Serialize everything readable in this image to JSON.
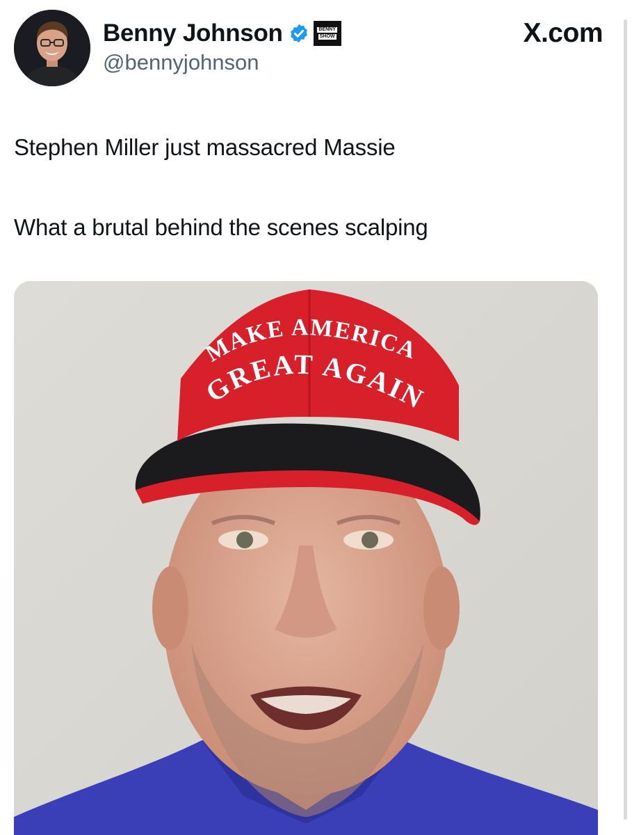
{
  "site_label": "X.com",
  "author": {
    "display_name": "Benny Johnson",
    "handle": "@bennyjohnson",
    "verified": true,
    "affiliate_badge": [
      "BENNY",
      "SHOW"
    ]
  },
  "tweet": {
    "lines": [
      "Stephen Miller just massacred Massie",
      "What a brutal behind the scenes scalping"
    ]
  },
  "media": {
    "hat_text_top": "MAKE AMERICA",
    "hat_text_bottom": "GREAT AGAIN"
  },
  "icons": {
    "verified": "verified-badge-icon",
    "avatar": "profile-avatar-image"
  },
  "colors": {
    "verified_blue": "#1d9bf0",
    "hat_red": "#d8202a",
    "shirt_blue": "#3a3fb8"
  }
}
